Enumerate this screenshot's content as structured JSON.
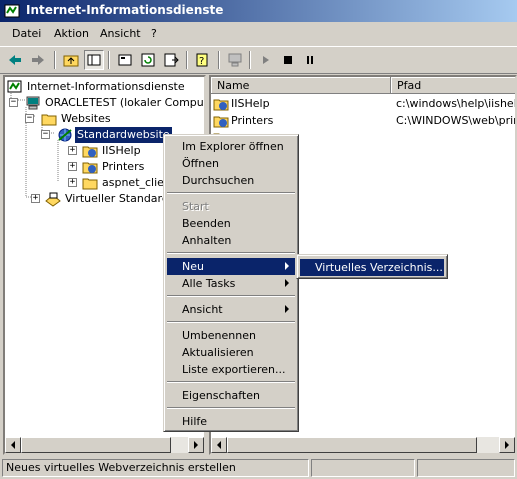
{
  "window": {
    "title": "Internet-Informationsdienste"
  },
  "menubar": {
    "items": [
      "Datei",
      "Aktion",
      "Ansicht",
      "?"
    ]
  },
  "toolbar": {
    "buttons": [
      "back-icon",
      "forward-icon",
      "up-folder-icon",
      "show-tree-icon",
      "properties-icon",
      "refresh-icon",
      "export-icon",
      "help-icon",
      "computer-icon",
      "start-icon",
      "stop-icon",
      "pause-icon"
    ]
  },
  "tree": {
    "root": "Internet-Informationsdienste",
    "computer": "ORACLETEST (lokaler Computer)",
    "websites": "Websites",
    "default_site": "Standardwebsite",
    "children": [
      "IISHelp",
      "Printers",
      "aspnet_client"
    ],
    "virtual_smtp": "Virtueller Standardserver für SMTP"
  },
  "list": {
    "columns": [
      "Name",
      "Pfad"
    ],
    "rows": [
      {
        "name": "IISHelp",
        "path": "c:\\windows\\help\\iishelp"
      },
      {
        "name": "Printers",
        "path": "C:\\WINDOWS\\web\\printers"
      }
    ]
  },
  "context_menu": {
    "items": [
      {
        "label": "Im Explorer öffnen"
      },
      {
        "label": "Öffnen"
      },
      {
        "label": "Durchsuchen"
      },
      {
        "label": "Start",
        "disabled": true
      },
      {
        "label": "Beenden"
      },
      {
        "label": "Anhalten"
      },
      {
        "label": "Neu",
        "submenu": true,
        "highlighted": true
      },
      {
        "label": "Alle Tasks",
        "submenu": true
      },
      {
        "label": "Ansicht",
        "submenu": true
      },
      {
        "label": "Umbenennen"
      },
      {
        "label": "Aktualisieren"
      },
      {
        "label": "Liste exportieren..."
      },
      {
        "label": "Eigenschaften"
      },
      {
        "label": "Hilfe"
      }
    ]
  },
  "submenu": {
    "items": [
      "Virtuelles Verzeichnis..."
    ]
  },
  "statusbar": {
    "text": "Neues virtuelles Webverzeichnis erstellen"
  },
  "colors": {
    "highlight": "#0a246a",
    "face": "#d4d0c8",
    "title_gradient_end": "#a6caf0"
  }
}
